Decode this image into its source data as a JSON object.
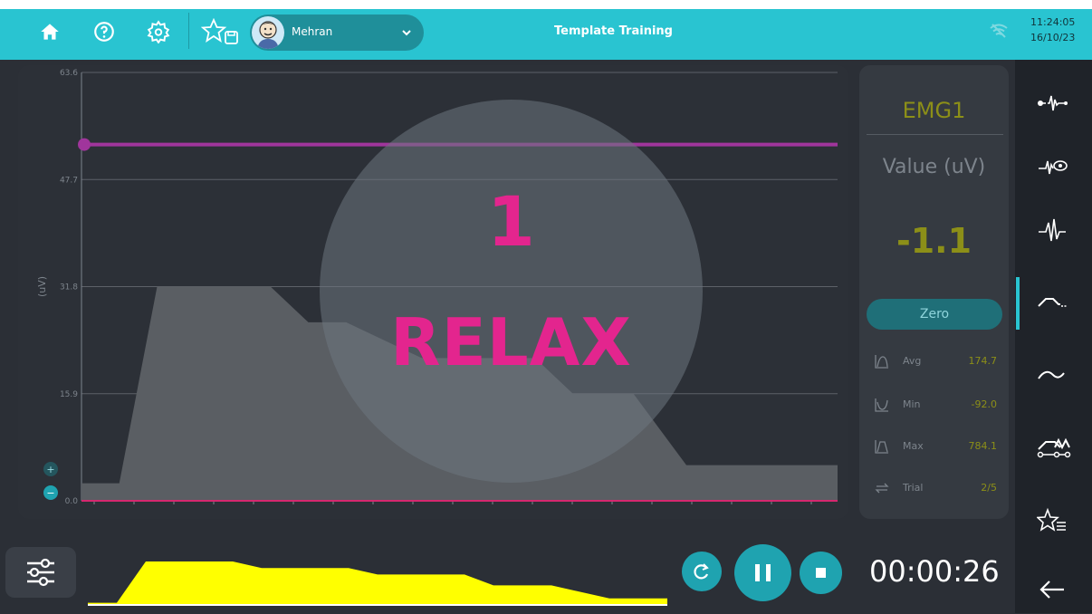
{
  "header": {
    "title": "Template Training",
    "user_name": "Mehran",
    "time": "11:24:05",
    "date": "16/10/23",
    "icons": [
      "home-icon",
      "help-icon",
      "settings-icon",
      "favorite-save-icon",
      "chevron-down-icon",
      "wifi-off-icon"
    ]
  },
  "sidebar": {
    "items": [
      {
        "icon": "emg-signal-icon"
      },
      {
        "icon": "signal-view-icon"
      },
      {
        "icon": "raw-signal-icon"
      },
      {
        "icon": "template-icon",
        "active": true
      },
      {
        "icon": "curve-icon"
      },
      {
        "icon": "multi-trial-icon"
      },
      {
        "icon": "favorites-list-icon"
      },
      {
        "icon": "back-arrow-icon"
      }
    ]
  },
  "overlay": {
    "count": "1",
    "message": "RELAX"
  },
  "channel": {
    "name": "EMG1",
    "value_label": "Value (uV)",
    "value": "-1.1",
    "zero_label": "Zero",
    "stats": [
      {
        "label": "Avg",
        "value": "174.7",
        "icon": "avg-icon"
      },
      {
        "label": "Min",
        "value": "-92.0",
        "icon": "min-icon"
      },
      {
        "label": "Max",
        "value": "784.1",
        "icon": "max-icon"
      },
      {
        "label": "Trial",
        "value": "2/5",
        "icon": "trial-icon"
      }
    ]
  },
  "chart_data": {
    "type": "area",
    "ylabel": "(uV)",
    "yticks": [
      "0.0",
      "15.9",
      "31.8",
      "47.7",
      "63.6"
    ],
    "ylim": [
      0,
      63.6
    ],
    "threshold": 52.9,
    "template": {
      "x": [
        0,
        5,
        10,
        25,
        30,
        35,
        45,
        60,
        65,
        73,
        80,
        90,
        100
      ],
      "y": [
        2.6,
        2.6,
        31.8,
        31.8,
        26.5,
        26.5,
        21.2,
        21.2,
        15.9,
        15.9,
        5.3,
        5.3,
        5.3
      ]
    },
    "colors": {
      "template": "#5a5e63",
      "threshold": "#a0359c",
      "signal": "#d6286f"
    },
    "zoom_in": "+",
    "zoom_out": "−"
  },
  "footer": {
    "timer": "00:00:26",
    "mini_chart": {
      "x": [
        0,
        5,
        10,
        25,
        30,
        45,
        50,
        65,
        70,
        80,
        90,
        100
      ],
      "y": [
        0.05,
        0.05,
        1,
        1,
        0.85,
        0.85,
        0.7,
        0.7,
        0.45,
        0.45,
        0.15,
        0.15
      ]
    },
    "colors": {
      "mini_fill": "#ffff00",
      "accent": "#1fa3b0"
    }
  }
}
